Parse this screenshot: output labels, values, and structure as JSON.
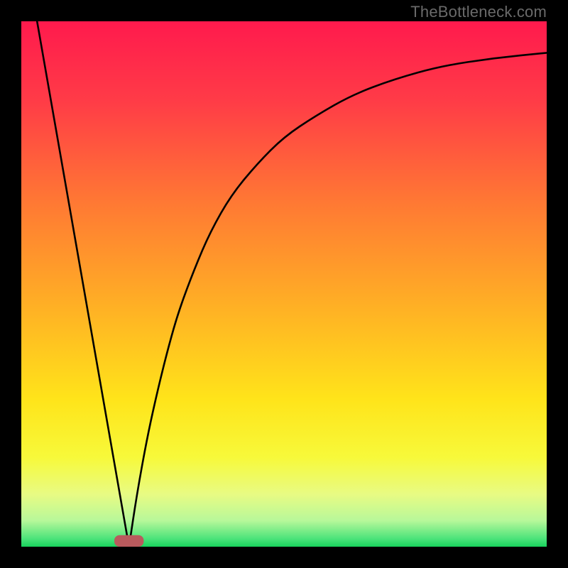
{
  "watermark": "TheBottleneck.com",
  "colors": {
    "frame": "#000000",
    "curve_stroke": "#000000",
    "marker_fill": "#b95a5d",
    "gradient_stops": [
      {
        "offset": 0.0,
        "color": "#ff1a4d"
      },
      {
        "offset": 0.15,
        "color": "#ff3b47"
      },
      {
        "offset": 0.35,
        "color": "#ff7a33"
      },
      {
        "offset": 0.55,
        "color": "#ffb224"
      },
      {
        "offset": 0.72,
        "color": "#ffe41a"
      },
      {
        "offset": 0.83,
        "color": "#f7f93a"
      },
      {
        "offset": 0.9,
        "color": "#e8fb83"
      },
      {
        "offset": 0.95,
        "color": "#b8f89a"
      },
      {
        "offset": 0.985,
        "color": "#4be37a"
      },
      {
        "offset": 1.0,
        "color": "#18d35c"
      }
    ]
  },
  "chart_data": {
    "type": "line",
    "title": "",
    "xlabel": "",
    "ylabel": "",
    "xlim": [
      0,
      100
    ],
    "ylim": [
      0,
      100
    ],
    "series": [
      {
        "name": "left-line",
        "x": [
          3,
          20.5
        ],
        "y": [
          100,
          0
        ]
      },
      {
        "name": "right-curve",
        "x": [
          20.5,
          22,
          24,
          26,
          28,
          30,
          33,
          36,
          40,
          45,
          50,
          56,
          63,
          71,
          80,
          90,
          100
        ],
        "y": [
          0,
          10,
          21,
          30,
          38,
          45,
          53,
          60,
          67,
          73,
          78,
          82,
          86,
          89,
          91.5,
          93,
          94
        ]
      }
    ],
    "marker": {
      "x_center": 20.5,
      "y": 0,
      "half_width": 2.8,
      "height": 2.2
    }
  }
}
